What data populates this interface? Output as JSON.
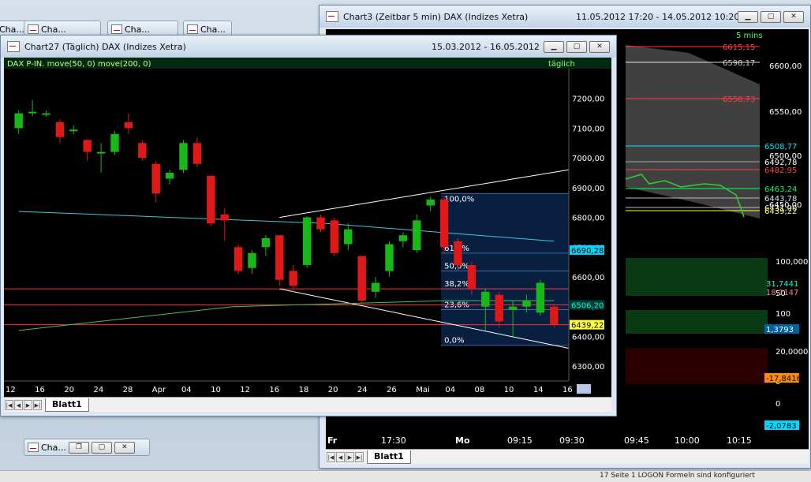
{
  "desktop": {
    "minimized": [
      "Cha...",
      "Cha...",
      "Cha...",
      "Cha..."
    ],
    "status_text": "17   Seite 1   LOGON   Formeln sind konfiguriert"
  },
  "back_window": {
    "title": "Chart3 (Zeitbar 5 min)  DAX (Indizes Xetra)",
    "date_range": "11.05.2012 17:20 - 14.05.2012 10:20",
    "interval_label": "5 mins",
    "price_ticks": [
      "6600,00",
      "6550,00",
      "6500,00",
      "6450,00"
    ],
    "price_labels": [
      {
        "text": "6615,15",
        "color": "#ff4040"
      },
      {
        "text": "6598,17",
        "color": "#cfcfcf"
      },
      {
        "text": "6558,73",
        "color": "#ff4040"
      },
      {
        "text": "6508,77",
        "color": "#00e5ff"
      },
      {
        "text": "6492,78",
        "color": "#ffffff"
      },
      {
        "text": "6482,95",
        "color": "#ff4040"
      },
      {
        "text": "6463,24",
        "color": "#00ff60"
      },
      {
        "text": "6443,78",
        "color": "#e0e0e0"
      },
      {
        "text": "6431,00",
        "color": "#e0e0e0"
      },
      {
        "text": "6439,22",
        "color": "#ffff40"
      }
    ],
    "ind1": {
      "ticks": [
        "100,0000",
        "50"
      ],
      "val_a": "31,7441",
      "val_b": "18,1147"
    },
    "ind2": {
      "ticks": [
        "100",
        "0"
      ],
      "value": "1,3793"
    },
    "ind3": {
      "ticks": [
        "20,0000",
        "0"
      ],
      "value": "-17,8416"
    },
    "ind4": {
      "ticks": [
        "0"
      ],
      "value": "-2,0783"
    },
    "time_axis": [
      "Fr",
      "17:30",
      "Mo",
      "09:15",
      "09:30",
      "09:45",
      "10:00",
      "10:15"
    ],
    "sheet_tab": "Blatt1"
  },
  "front_window": {
    "title": "Chart27 (Täglich)  DAX (Indizes Xetra)",
    "date_range": "15.03.2012 - 16.05.2012",
    "legend": "DAX P-IN.  move(50, 0)  move(200, 0)",
    "interval_label": "täglich",
    "sheet_tab": "Blatt1",
    "chart_data": {
      "type": "candlestick",
      "ylim": [
        6250,
        7300
      ],
      "y_ticks": [
        "6300,00",
        "6400,00",
        "6500,00",
        "6600,00",
        "6700,00",
        "6800,00",
        "6900,00",
        "7000,00",
        "7100,00",
        "7200,00"
      ],
      "x_ticks": [
        "12",
        "16",
        "20",
        "24",
        "28",
        "Apr",
        "04",
        "10",
        "12",
        "16",
        "18",
        "20",
        "24",
        "26",
        "Mai",
        "04",
        "08",
        "10",
        "14",
        "16"
      ],
      "candles": [
        {
          "o": 7100,
          "c": 7150,
          "h": 7160,
          "l": 7080
        },
        {
          "o": 7150,
          "c": 7155,
          "h": 7195,
          "l": 7140
        },
        {
          "o": 7150,
          "c": 7150,
          "h": 7160,
          "l": 7140
        },
        {
          "o": 7120,
          "c": 7070,
          "h": 7130,
          "l": 7050
        },
        {
          "o": 7090,
          "c": 7095,
          "h": 7110,
          "l": 7080
        },
        {
          "o": 7060,
          "c": 7020,
          "h": 7065,
          "l": 6990
        },
        {
          "o": 7020,
          "c": 7020,
          "h": 7050,
          "l": 6950
        },
        {
          "o": 7020,
          "c": 7080,
          "h": 7090,
          "l": 7010
        },
        {
          "o": 7120,
          "c": 7100,
          "h": 7150,
          "l": 7080
        },
        {
          "o": 7050,
          "c": 7000,
          "h": 7060,
          "l": 6990
        },
        {
          "o": 6980,
          "c": 6880,
          "h": 6990,
          "l": 6850
        },
        {
          "o": 6930,
          "c": 6950,
          "h": 6960,
          "l": 6910
        },
        {
          "o": 6960,
          "c": 7050,
          "h": 7060,
          "l": 6950
        },
        {
          "o": 7050,
          "c": 6980,
          "h": 7070,
          "l": 6970
        },
        {
          "o": 6940,
          "c": 6780,
          "h": 6940,
          "l": 6770
        },
        {
          "o": 6810,
          "c": 6790,
          "h": 6830,
          "l": 6720
        },
        {
          "o": 6700,
          "c": 6620,
          "h": 6710,
          "l": 6610
        },
        {
          "o": 6630,
          "c": 6680,
          "h": 6690,
          "l": 6610
        },
        {
          "o": 6700,
          "c": 6730,
          "h": 6740,
          "l": 6670
        },
        {
          "o": 6740,
          "c": 6590,
          "h": 6740,
          "l": 6570
        },
        {
          "o": 6620,
          "c": 6570,
          "h": 6640,
          "l": 6550
        },
        {
          "o": 6640,
          "c": 6800,
          "h": 6805,
          "l": 6630
        },
        {
          "o": 6800,
          "c": 6760,
          "h": 6810,
          "l": 6750
        },
        {
          "o": 6790,
          "c": 6680,
          "h": 6800,
          "l": 6670
        },
        {
          "o": 6710,
          "c": 6760,
          "h": 6780,
          "l": 6690
        },
        {
          "o": 6670,
          "c": 6520,
          "h": 6670,
          "l": 6510
        },
        {
          "o": 6550,
          "c": 6580,
          "h": 6600,
          "l": 6530
        },
        {
          "o": 6620,
          "c": 6710,
          "h": 6720,
          "l": 6600
        },
        {
          "o": 6720,
          "c": 6740,
          "h": 6750,
          "l": 6700
        },
        {
          "o": 6690,
          "c": 6790,
          "h": 6810,
          "l": 6680
        },
        {
          "o": 6840,
          "c": 6860,
          "h": 6870,
          "l": 6820
        },
        {
          "o": 6860,
          "c": 6700,
          "h": 6870,
          "l": 6680
        },
        {
          "o": 6720,
          "c": 6640,
          "h": 6730,
          "l": 6620
        },
        {
          "o": 6640,
          "c": 6560,
          "h": 6650,
          "l": 6540
        },
        {
          "o": 6500,
          "c": 6550,
          "h": 6560,
          "l": 6420
        },
        {
          "o": 6540,
          "c": 6450,
          "h": 6550,
          "l": 6430
        },
        {
          "o": 6490,
          "c": 6500,
          "h": 6520,
          "l": 6400
        },
        {
          "o": 6500,
          "c": 6520,
          "h": 6540,
          "l": 6480
        },
        {
          "o": 6480,
          "c": 6580,
          "h": 6590,
          "l": 6470
        },
        {
          "o": 6500,
          "c": 6440,
          "h": 6510,
          "l": 6430
        }
      ],
      "ma50": [
        6820,
        6810,
        6800,
        6790,
        6780,
        6760,
        6740,
        6720
      ],
      "ma200": [
        6420,
        6460,
        6500,
        6510,
        6520,
        6520
      ],
      "fib_levels": [
        {
          "label": "100,0%",
          "value": 6880
        },
        {
          "label": "61,8%",
          "value": 6680
        },
        {
          "label": "50,0%",
          "value": 6620
        },
        {
          "label": "38,2%",
          "value": 6560
        },
        {
          "label": "23,6%",
          "value": 6490
        },
        {
          "label": "0,0%",
          "value": 6370
        }
      ],
      "hlines": [
        {
          "value": 6560,
          "color": "#ff3030"
        },
        {
          "value": 6506.2,
          "color": "#ff3030"
        },
        {
          "value": 6439.22,
          "color": "#ff3030"
        }
      ],
      "price_labels": [
        {
          "text": "6690,28",
          "value": 6690.28,
          "bg": "#00d8ff",
          "fg": "#000"
        },
        {
          "text": "6506,20",
          "value": 6506.2,
          "bg": "#003a3a",
          "fg": "#00ffcc"
        },
        {
          "text": "6439,22",
          "value": 6439.22,
          "bg": "#ffff40",
          "fg": "#000"
        }
      ]
    }
  }
}
